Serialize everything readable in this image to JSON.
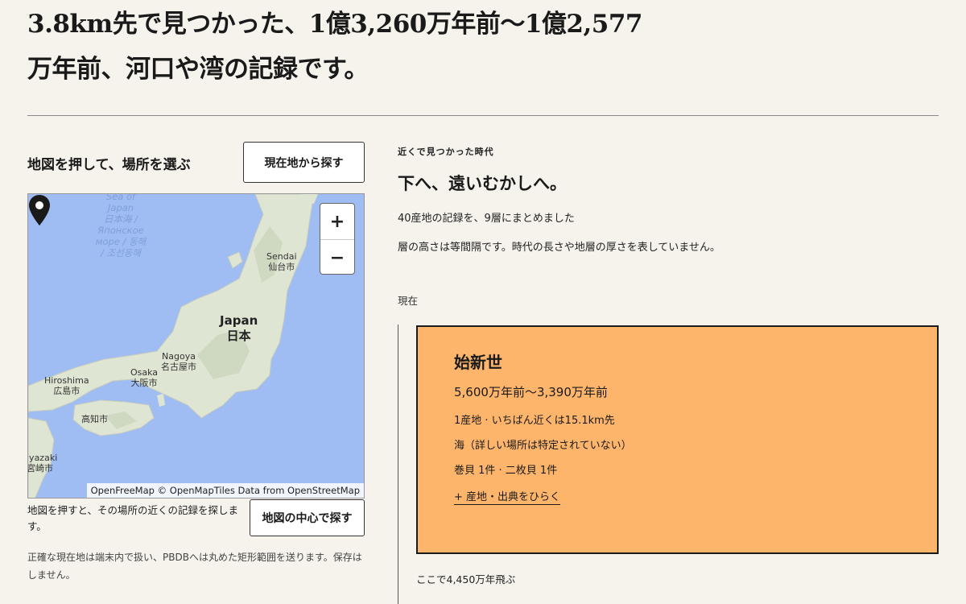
{
  "headline": {
    "line1": "3.8km先で見つかった、1億3,260万年前〜1億2,577",
    "line2": "万年前、河口や湾の記録です。"
  },
  "map_panel": {
    "title": "地図を押して、場所を選ぶ",
    "locate_button": "現在地から探す",
    "zoom_in": "+",
    "zoom_out": "−",
    "attribution": "OpenFreeMap © OpenMapTiles Data from OpenStreetMap",
    "labels": {
      "sea_of_japan": [
        "Sea of",
        "Japan",
        "日本海 /",
        "Японское",
        "море / 동해",
        "/ 조선동해"
      ],
      "sendai": "Sendai",
      "sendai_jp": "仙台市",
      "japan": "Japan",
      "japan_jp": "日本",
      "nagoya": "Nagoya",
      "nagoya_jp": "名古屋市",
      "osaka": "Osaka",
      "osaka_jp": "大阪市",
      "hiroshima": "Hiroshima",
      "hiroshima_jp": "広島市",
      "kochi_jp": "高知市",
      "miyazaki": "iyazaki",
      "miyazaki_jp": "宮崎市"
    },
    "help_text": "地図を押すと、その場所の近くの記録を探します。",
    "center_button": "地図の中心で探す",
    "privacy_text": "正確な現在地は端末内で扱い、PBDBへは丸めた矩形範囲を送ります。保存はしません。"
  },
  "timeline": {
    "eyebrow": "近くで見つかった時代",
    "title": "下へ、遠いむかしへ。",
    "summary": "40産地の記録を、9層にまとめました",
    "note": "層の高さは等間隔です。時代の長さや地層の厚さを表していません。",
    "now_label": "現在",
    "strata": [
      {
        "name": "始新世",
        "range": "5,600万年前〜3,390万年前",
        "sites": "1産地 · いちばん近くは15.1km先",
        "environment": "海（詳しい場所は特定されていない）",
        "fossils": "巻貝 1件 · 二枚貝 1件",
        "toggle": "+ 産地・出典をひらく",
        "color": "#fdb56c"
      }
    ],
    "gap_label": "ここで4,450万年飛ぶ"
  }
}
